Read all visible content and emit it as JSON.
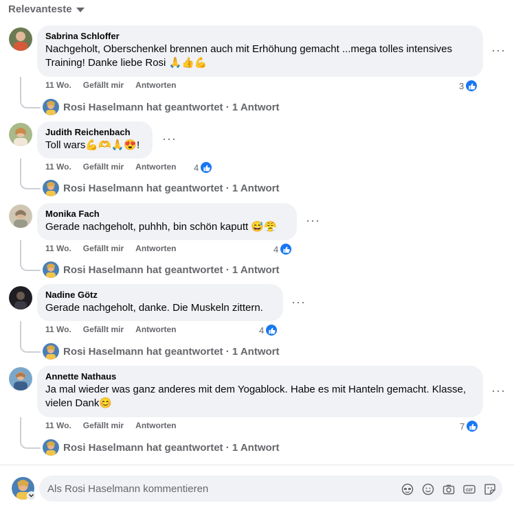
{
  "sort_label": "Relevanteste",
  "comments": [
    {
      "author": "Sabrina Schloffer",
      "text": "Nachgeholt, Oberschenkel brennen auch mit Erhöhung gemacht ...mega tolles intensives Training! Danke liebe Rosi 🙏👍💪",
      "time": "11 Wo.",
      "like_label": "Gefällt mir",
      "reply_label": "Antworten",
      "likes": "3",
      "replied_text": "Rosi Haselmann hat geantwortet · 1 Antwort"
    },
    {
      "author": "Judith Reichenbach",
      "text": "Toll wars💪🫶🙏😍!",
      "time": "11 Wo.",
      "like_label": "Gefällt mir",
      "reply_label": "Antworten",
      "likes": "4",
      "replied_text": "Rosi Haselmann hat geantwortet · 1 Antwort"
    },
    {
      "author": "Monika Fach",
      "text": "Gerade nachgeholt, puhhh, bin schön kaputt 😅😤",
      "time": "11 Wo.",
      "like_label": "Gefällt mir",
      "reply_label": "Antworten",
      "likes": "4",
      "replied_text": "Rosi Haselmann hat geantwortet · 1 Antwort"
    },
    {
      "author": "Nadine Götz",
      "text": "Gerade nachgeholt, danke. Die Muskeln zittern.",
      "time": "11 Wo.",
      "like_label": "Gefällt mir",
      "reply_label": "Antworten",
      "likes": "4",
      "replied_text": "Rosi Haselmann hat geantwortet · 1 Antwort"
    },
    {
      "author": "Annette Nathaus",
      "text": "Ja mal wieder was ganz anderes mit dem Yogablock. Habe es mit Hanteln gemacht. Klasse, vielen Dank😊",
      "time": "11 Wo.",
      "like_label": "Gefällt mir",
      "reply_label": "Antworten",
      "likes": "7",
      "replied_text": "Rosi Haselmann hat geantwortet · 1 Antwort"
    }
  ],
  "composer": {
    "placeholder": "Als Rosi Haselmann kommentieren",
    "tools": [
      "avatar-sticker-icon",
      "emoji-icon",
      "camera-icon",
      "gif-icon",
      "sticker-icon"
    ]
  },
  "colors": {
    "like_blue": "#1877f2",
    "bubble_bg": "#f0f2f5",
    "muted": "#65676b"
  }
}
